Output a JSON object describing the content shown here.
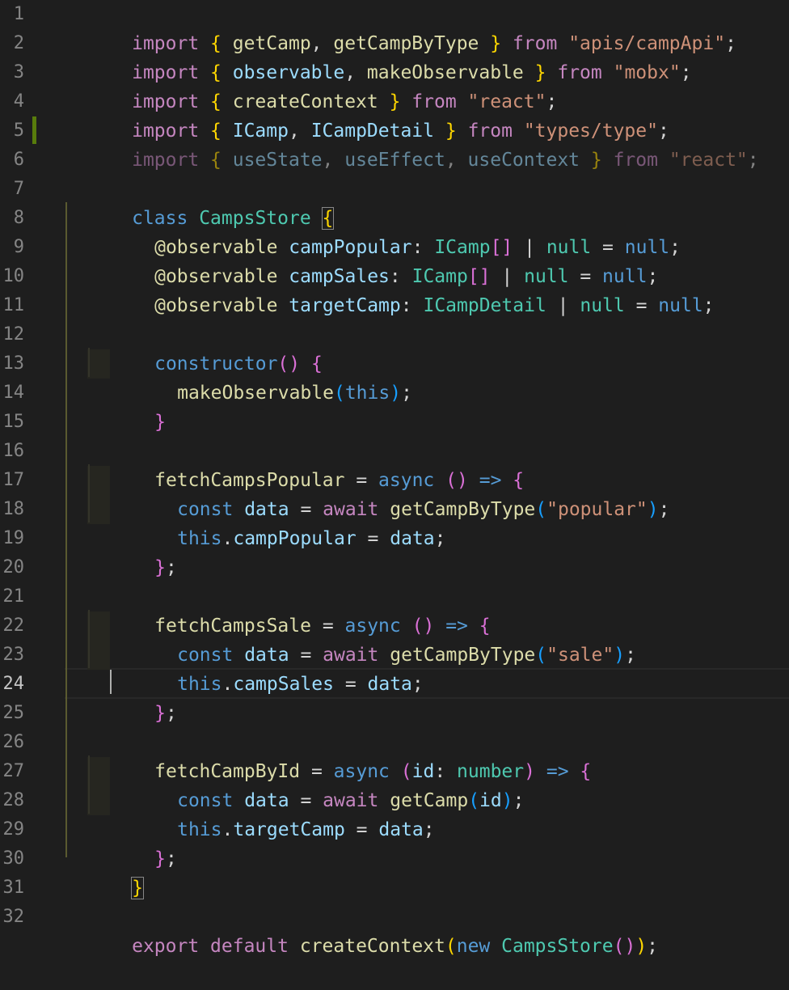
{
  "editor": {
    "language": "typescript",
    "theme_background": "#1e1e1e",
    "active_line": "24",
    "line_numbers": [
      "1",
      "2",
      "3",
      "4",
      "5",
      "6",
      "7",
      "8",
      "9",
      "10",
      "11",
      "12",
      "13",
      "14",
      "15",
      "16",
      "17",
      "18",
      "19",
      "20",
      "21",
      "22",
      "23",
      "24",
      "25",
      "26",
      "27",
      "28",
      "29",
      "30",
      "31",
      "32"
    ]
  },
  "code": {
    "l1": {
      "kw": "import",
      "o": " { ",
      "a": "getCamp",
      "c1": ", ",
      "b": "getCampByType",
      "cl": " } ",
      "from": "from",
      "sp": " ",
      "str": "\"apis/campApi\"",
      "end": ";"
    },
    "l2": {
      "kw": "import",
      "o": " { ",
      "a": "observable",
      "c1": ", ",
      "b": "makeObservable",
      "cl": " } ",
      "from": "from",
      "sp": " ",
      "str": "\"mobx\"",
      "end": ";"
    },
    "l3": {
      "kw": "import",
      "o": " { ",
      "a": "createContext",
      "cl": " } ",
      "from": "from",
      "sp": " ",
      "str": "\"react\"",
      "end": ";"
    },
    "l4": {
      "kw": "import",
      "o": " { ",
      "a": "ICamp",
      "c1": ", ",
      "b": "ICampDetail",
      "cl": " } ",
      "from": "from",
      "sp": " ",
      "str": "\"types/type\"",
      "end": ";"
    },
    "l5": {
      "kw": "import",
      "o": " { ",
      "a": "useState",
      "c1": ", ",
      "b": "useEffect",
      "c2": ", ",
      "c": "useContext",
      "cl": " } ",
      "from": "from",
      "sp": " ",
      "str": "\"react\"",
      "end": ";"
    },
    "l7": {
      "kw": "class",
      "sp": " ",
      "name": "CampsStore",
      "sp2": " ",
      "brace": "{"
    },
    "l8": {
      "dec": "@observable",
      "sp": " ",
      "prop": "campPopular",
      "colon": ": ",
      "type": "ICamp",
      "arr": "[]",
      "pipe": " | ",
      "n1": "null",
      "eq": " = ",
      "n2": "null",
      "end": ";"
    },
    "l9": {
      "dec": "@observable",
      "sp": " ",
      "prop": "campSales",
      "colon": ": ",
      "type": "ICamp",
      "arr": "[]",
      "pipe": " | ",
      "n1": "null",
      "eq": " = ",
      "n2": "null",
      "end": ";"
    },
    "l10": {
      "dec": "@observable",
      "sp": " ",
      "prop": "targetCamp",
      "colon": ": ",
      "type": "ICampDetail",
      "pipe": " | ",
      "n1": "null",
      "eq": " = ",
      "n2": "null",
      "end": ";"
    },
    "l12": {
      "kw": "constructor",
      "paren": "()",
      "sp": " ",
      "brace": "{"
    },
    "l13": {
      "fn": "makeObservable",
      "po": "(",
      "arg": "this",
      "pc": ")",
      "end": ";"
    },
    "l14": {
      "brace": "}"
    },
    "l16": {
      "name": "fetchCampsPopular",
      "eq": " = ",
      "async": "async",
      "sp": " ",
      "paren": "()",
      "sp2": " ",
      "arrow": "=>",
      "sp3": " ",
      "brace": "{"
    },
    "l17": {
      "const": "const",
      "sp": " ",
      "var": "data",
      "eq": " = ",
      "await": "await",
      "sp2": " ",
      "fn": "getCampByType",
      "po": "(",
      "str": "\"popular\"",
      "pc": ")",
      "end": ";"
    },
    "l18": {
      "this": "this",
      "dot": ".",
      "prop": "campPopular",
      "eq": " = ",
      "var": "data",
      "end": ";"
    },
    "l19": {
      "brace": "}",
      "end": ";"
    },
    "l21": {
      "name": "fetchCampsSale",
      "eq": " = ",
      "async": "async",
      "sp": " ",
      "paren": "()",
      "sp2": " ",
      "arrow": "=>",
      "sp3": " ",
      "brace": "{"
    },
    "l22": {
      "const": "const",
      "sp": " ",
      "var": "data",
      "eq": " = ",
      "await": "await",
      "sp2": " ",
      "fn": "getCampByType",
      "po": "(",
      "str": "\"sale\"",
      "pc": ")",
      "end": ";"
    },
    "l23": {
      "this": "this",
      "dot": ".",
      "prop": "campSales",
      "eq": " = ",
      "var": "data",
      "end": ";"
    },
    "l24": {
      "brace": "}",
      "end": ";"
    },
    "l26": {
      "name": "fetchCampById",
      "eq": " = ",
      "async": "async",
      "sp": " ",
      "po": "(",
      "param": "id",
      "colon": ": ",
      "type": "number",
      "pc": ")",
      "sp2": " ",
      "arrow": "=>",
      "sp3": " ",
      "brace": "{"
    },
    "l27": {
      "const": "const",
      "sp": " ",
      "var": "data",
      "eq": " = ",
      "await": "await",
      "sp2": " ",
      "fn": "getCamp",
      "po": "(",
      "arg": "id",
      "pc": ")",
      "end": ";"
    },
    "l28": {
      "this": "this",
      "dot": ".",
      "prop": "targetCamp",
      "eq": " = ",
      "var": "data",
      "end": ";"
    },
    "l29": {
      "brace": "}",
      "end": ";"
    },
    "l30": {
      "brace": "}"
    },
    "l32": {
      "export": "export",
      "sp": " ",
      "default": "default",
      "sp2": " ",
      "fn": "createContext",
      "po": "(",
      "new": "new",
      "sp3": " ",
      "cls": "CampsStore",
      "call": "()",
      "pc": ")",
      "end": ";"
    }
  }
}
